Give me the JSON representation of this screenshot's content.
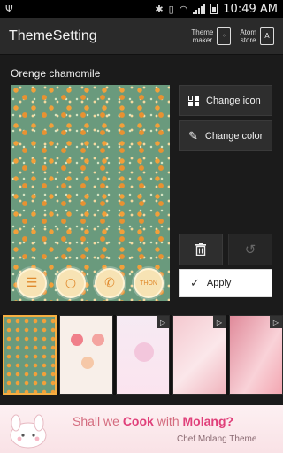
{
  "status_bar": {
    "time": "10:49 AM"
  },
  "action_bar": {
    "title": "ThemeSetting",
    "theme_maker_label": "Theme\nmaker",
    "atom_store_label": "Atom\nstore",
    "atom_store_icon_letter": "A"
  },
  "theme": {
    "name": "Orenge chamomile"
  },
  "preview": {
    "dock_icons": [
      {
        "icon": "calendar-icon"
      },
      {
        "icon": "search-icon"
      },
      {
        "icon": "phone-icon"
      },
      {
        "icon": "theme-icon",
        "text": "THON"
      }
    ]
  },
  "buttons": {
    "change_icon": "Change icon",
    "change_color": "Change color",
    "apply": "Apply"
  },
  "thumbnails": [
    {
      "selected": true,
      "has_play": false
    },
    {
      "selected": false,
      "has_play": false
    },
    {
      "selected": false,
      "has_play": true
    },
    {
      "selected": false,
      "has_play": true
    },
    {
      "selected": false,
      "has_play": true
    }
  ],
  "ad": {
    "line1_prefix": "Shall we ",
    "line1_cook": "Cook",
    "line1_mid": " with ",
    "line1_molang": "Molang?",
    "line2": "Chef Molang Theme"
  },
  "colors": {
    "accent_orange": "#f2a03a",
    "preview_green": "#6a9a7d",
    "ad_pink": "#e0407a"
  }
}
